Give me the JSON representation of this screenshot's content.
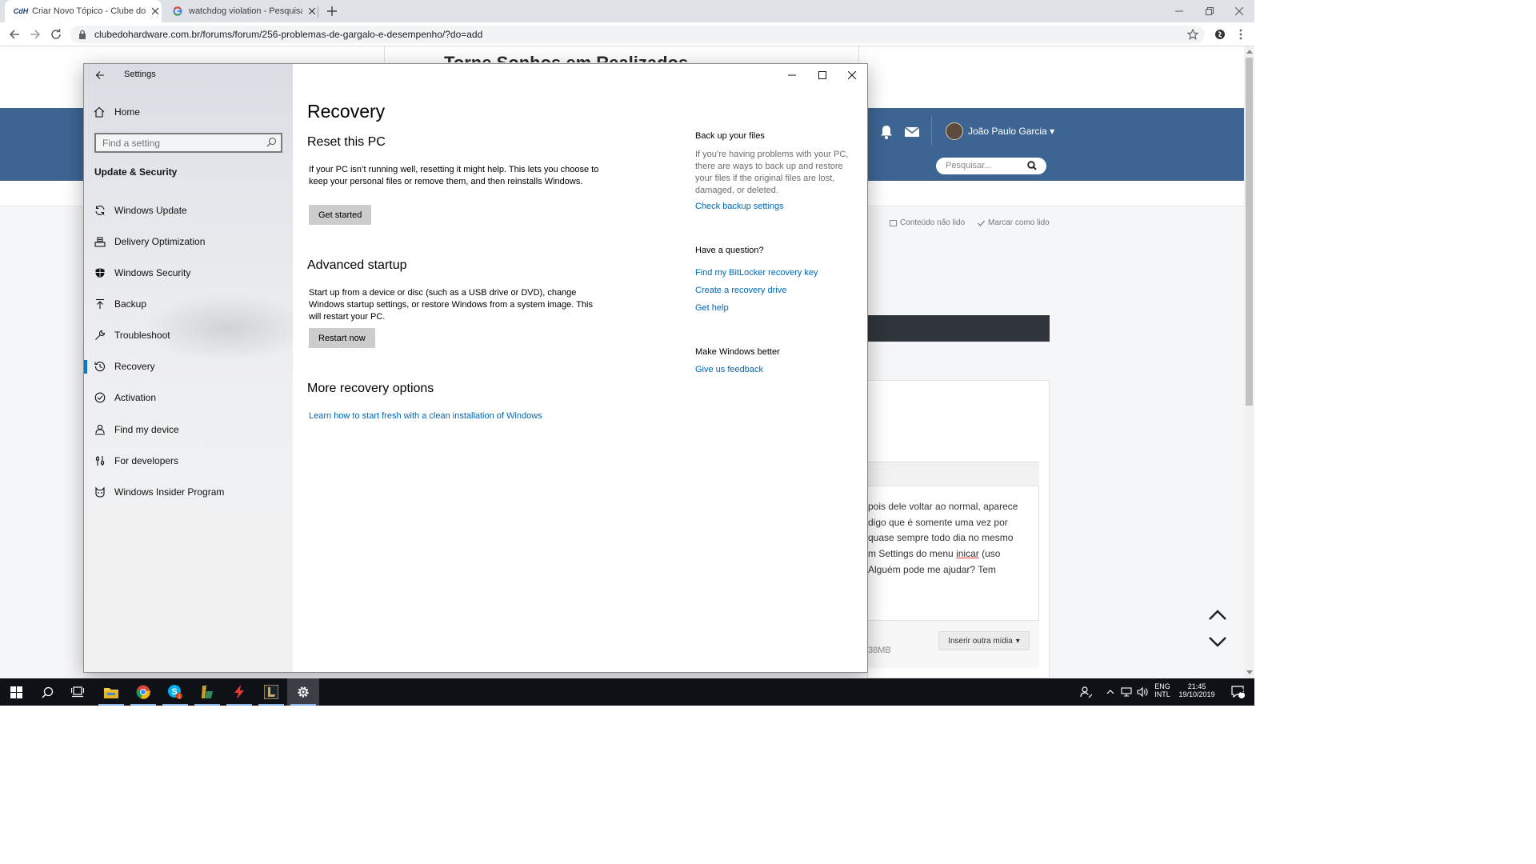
{
  "browser": {
    "tabs": [
      {
        "label": "Criar Novo Tópico - Clube do Hardware",
        "favicon": "CdH",
        "active": true
      },
      {
        "label": "watchdog violation - Pesquisa Google",
        "favicon": "G",
        "active": false
      }
    ],
    "url": "clubedohardware.com.br/forums/forum/256-problemas-de-gargalo-e-desempenho/?do=add"
  },
  "webpage": {
    "heading": "Torne Sonhos em Realizados",
    "user_name": "João Paulo Garcia",
    "search_placeholder": "Pesquisar...",
    "unread_label": "Conteúdo não lido",
    "mark_read_label": "Marcar como lido",
    "editor_lines": [
      "pois dele voltar ao normal, aparece",
      "digo que é somente uma vez por",
      "quase sempre todo dia no mesmo",
      "m Settings do menu ",
      "Alguém pode me ajudar? Tem"
    ],
    "editor_underlined": "inicar",
    "editor_after_underlined": " (uso",
    "size_label": "38MB",
    "insert_media_label": "Inserir outra mídia"
  },
  "settings": {
    "window_title": "Settings",
    "home_label": "Home",
    "search_placeholder": "Find a setting",
    "group_label": "Update & Security",
    "nav_items": [
      {
        "label": "Windows Update",
        "icon": "sync-icon",
        "selected": false
      },
      {
        "label": "Delivery Optimization",
        "icon": "delivery-icon",
        "selected": false
      },
      {
        "label": "Windows Security",
        "icon": "shield-icon",
        "selected": false
      },
      {
        "label": "Backup",
        "icon": "upload-icon",
        "selected": false
      },
      {
        "label": "Troubleshoot",
        "icon": "wrench-icon",
        "selected": false
      },
      {
        "label": "Recovery",
        "icon": "history-icon",
        "selected": true
      },
      {
        "label": "Activation",
        "icon": "check-circle-icon",
        "selected": false
      },
      {
        "label": "Find my device",
        "icon": "person-pin-icon",
        "selected": false
      },
      {
        "label": "For developers",
        "icon": "sliders-icon",
        "selected": false
      },
      {
        "label": "Windows Insider Program",
        "icon": "insider-cat-icon",
        "selected": false
      }
    ],
    "page_title": "Recovery",
    "reset": {
      "title": "Reset this PC",
      "text": "If your PC isn’t running well, resetting it might help. This lets you choose to keep your personal files or remove them, and then reinstalls Windows.",
      "button": "Get started"
    },
    "advanced": {
      "title": "Advanced startup",
      "text": "Start up from a device or disc (such as a USB drive or DVD), change Windows startup settings, or restore Windows from a system image. This will restart your PC.",
      "button": "Restart now"
    },
    "more": {
      "title": "More recovery options",
      "link": "Learn how to start fresh with a clean installation of Windows"
    },
    "right_panel": {
      "backup_title": "Back up your files",
      "backup_text": "If you’re having problems with your PC, there are ways to back up and restore your files if the original files are lost, damaged, or deleted.",
      "backup_link": "Check backup settings",
      "question_title": "Have a question?",
      "question_links": [
        "Find my BitLocker recovery key",
        "Create a recovery drive",
        "Get help"
      ],
      "better_title": "Make Windows better",
      "feedback_link": "Give us feedback"
    }
  },
  "taskbar": {
    "apps": [
      "file-explorer-icon",
      "chrome-icon",
      "skype-icon",
      "launcher-icon",
      "nitro-icon",
      "league-icon",
      "settings-gear-icon"
    ],
    "language": "ENG",
    "layout": "INTL",
    "time": "21:45",
    "date": "19/10/2019",
    "notification_count": "2"
  },
  "colors": {
    "accent": "#0078d7",
    "link": "#0067b8",
    "site_header": "#3d6594",
    "taskbar": "#0e1116"
  }
}
